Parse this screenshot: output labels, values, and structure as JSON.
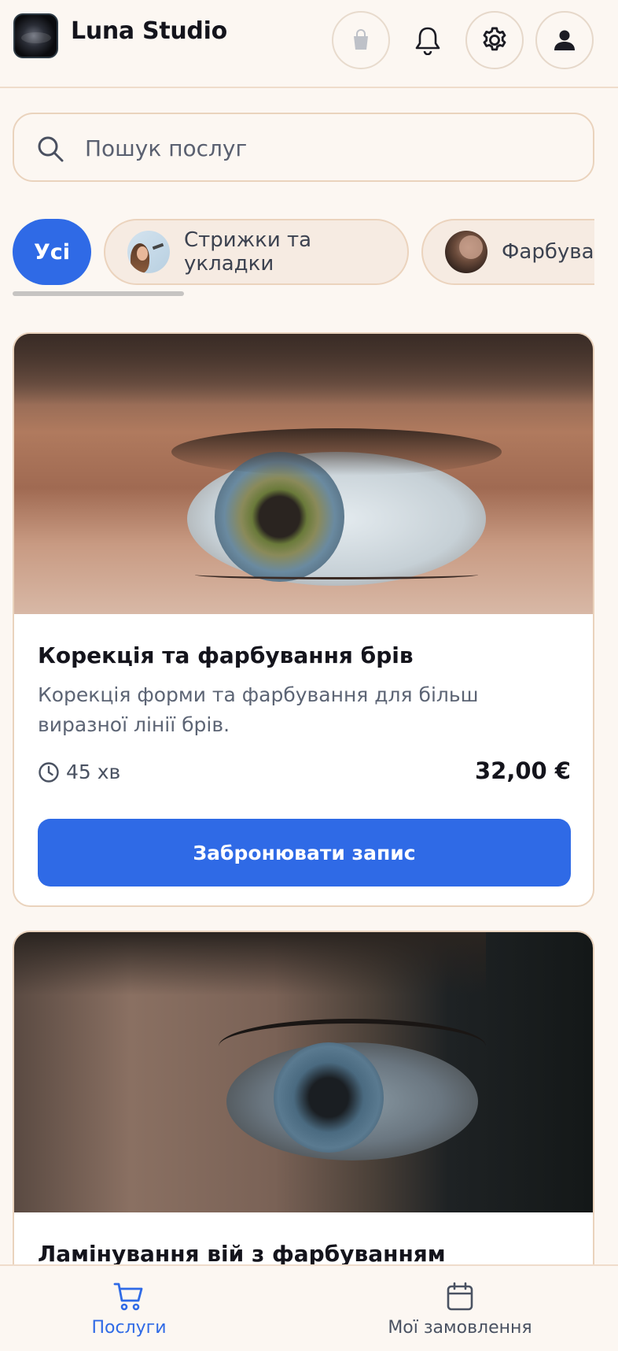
{
  "header": {
    "app_title": "Luna Studio",
    "icons": [
      "shopping-bag-icon",
      "bell-icon",
      "gear-icon",
      "user-icon"
    ]
  },
  "search": {
    "placeholder": "Пошук послуг"
  },
  "categories": [
    {
      "label": "Усі",
      "active": true
    },
    {
      "label": "Стрижки та укладки",
      "active": false
    },
    {
      "label": "Фарбуван",
      "active": false
    }
  ],
  "services": [
    {
      "title": "Корекція та фарбування брів",
      "description": "Корекція форми та фарбування для більш виразної лінії брів.",
      "duration": "45 хв",
      "price": "32,00 €",
      "button_label": "Забронювати запис"
    },
    {
      "title": "Ламінування вій з фарбуванням"
    }
  ],
  "bottom_nav": {
    "items": [
      {
        "label": "Послуги",
        "icon": "cart-icon",
        "active": true
      },
      {
        "label": "Мої замовлення",
        "icon": "calendar-icon",
        "active": false
      }
    ]
  },
  "colors": {
    "accent": "#2f6ae6",
    "background": "#fcf7f2",
    "border": "#ead3bd"
  }
}
